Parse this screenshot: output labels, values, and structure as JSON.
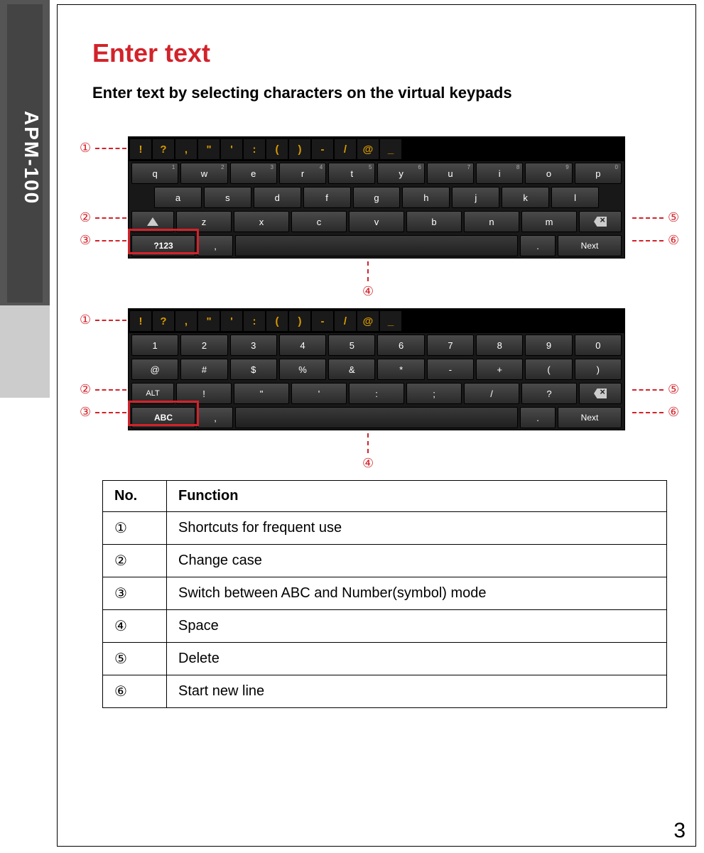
{
  "side_label": "APM-100",
  "title": "Enter text",
  "subtitle": "Enter text by selecting characters on the virtual keypads",
  "page_number": "3",
  "shortcut_keys": [
    "!",
    "?",
    ",",
    "\"",
    "'",
    ":",
    "(",
    ")",
    "-",
    "/",
    "@",
    "_"
  ],
  "keyboard_abc": {
    "row1": [
      [
        "q",
        "1"
      ],
      [
        "w",
        "2"
      ],
      [
        "e",
        "3"
      ],
      [
        "r",
        "4"
      ],
      [
        "t",
        "5"
      ],
      [
        "y",
        "6"
      ],
      [
        "u",
        "7"
      ],
      [
        "i",
        "8"
      ],
      [
        "o",
        "9"
      ],
      [
        "p",
        "0"
      ]
    ],
    "row2": [
      "a",
      "s",
      "d",
      "f",
      "g",
      "h",
      "j",
      "k",
      "l"
    ],
    "row3": [
      "z",
      "x",
      "c",
      "v",
      "b",
      "n",
      "m"
    ],
    "mode_label": "?123",
    "next_label": "Next",
    "comma": ",",
    "period": "."
  },
  "keyboard_num": {
    "row1": [
      "1",
      "2",
      "3",
      "4",
      "5",
      "6",
      "7",
      "8",
      "9",
      "0"
    ],
    "row2": [
      "@",
      "#",
      "$",
      "%",
      "&",
      "*",
      "-",
      "+",
      "(",
      ")"
    ],
    "row3": [
      "!",
      "\"",
      "'",
      ":",
      ";",
      "/",
      "?"
    ],
    "alt_label": "ALT",
    "mode_label": "ABC",
    "next_label": "Next",
    "comma": ",",
    "period": "."
  },
  "callouts": {
    "c1": "①",
    "c2": "②",
    "c3": "③",
    "c4": "④",
    "c5": "⑤",
    "c6": "⑥"
  },
  "table": {
    "header_no": "No.",
    "header_func": "Function",
    "rows": [
      {
        "no": "①",
        "func": "Shortcuts for frequent use"
      },
      {
        "no": "②",
        "func": "Change case"
      },
      {
        "no": "③",
        "func": "Switch between ABC and Number(symbol) mode"
      },
      {
        "no": "④",
        "func": "Space"
      },
      {
        "no": "⑤",
        "func": "Delete"
      },
      {
        "no": "⑥",
        "func": "Start new line"
      }
    ]
  }
}
